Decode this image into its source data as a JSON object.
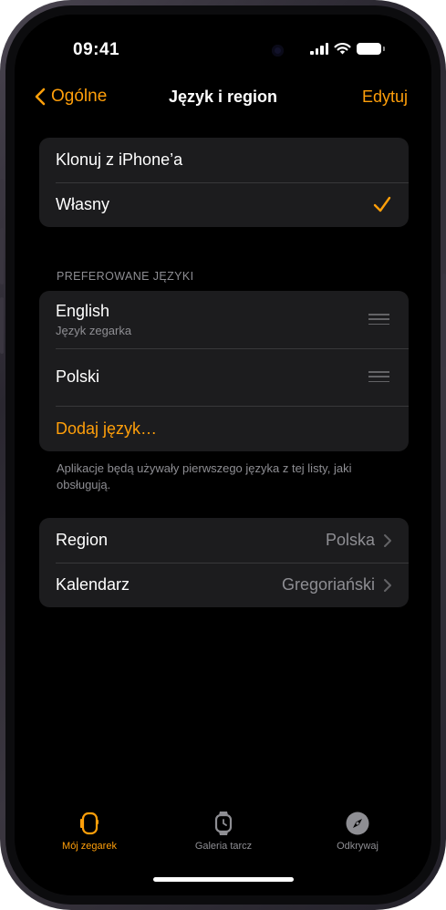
{
  "status_bar": {
    "time": "09:41"
  },
  "nav": {
    "back_label": "Ogólne",
    "title": "Język i region",
    "edit_label": "Edytuj"
  },
  "source_group": {
    "items": [
      {
        "label": "Klonuj z iPhone’a",
        "checked": false
      },
      {
        "label": "Własny",
        "checked": true
      }
    ]
  },
  "languages": {
    "header": "PREFEROWANE JĘZYKI",
    "items": [
      {
        "name": "English",
        "subtitle": "Język zegarka"
      },
      {
        "name": "Polski",
        "subtitle": ""
      }
    ],
    "add_label": "Dodaj język…",
    "footnote": "Aplikacje będą używały pierwszego języka z tej listy, jaki obsługują."
  },
  "region_group": {
    "items": [
      {
        "label": "Region",
        "value": "Polska"
      },
      {
        "label": "Kalendarz",
        "value": "Gregoriański"
      }
    ]
  },
  "tab_bar": {
    "tabs": [
      {
        "label": "Mój zegarek",
        "icon": "watch-icon",
        "active": true
      },
      {
        "label": "Galeria tarcz",
        "icon": "watch-face-icon",
        "active": false
      },
      {
        "label": "Odkrywaj",
        "icon": "compass-icon",
        "active": false
      }
    ]
  },
  "colors": {
    "accent": "#ff9f0a",
    "background": "#000000",
    "cell": "#1c1c1e",
    "secondary_text": "#8e8e93"
  }
}
